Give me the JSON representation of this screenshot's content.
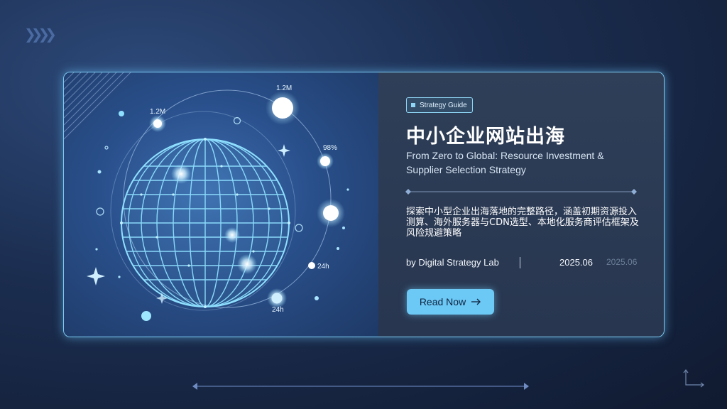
{
  "card": {
    "badge": {
      "icon": "square-icon",
      "label": "Strategy Guide"
    },
    "title": "中小企业网站出海",
    "subtitle": "From Zero to Global: Resource Investment & Supplier Selection Strategy",
    "description": "探索中小型企业出海落地的完整路径，涵盖初期资源投入测算、海外服务器与CDN选型、本地化服务商评估框架及风险规避策略",
    "author": "by Digital Strategy Lab",
    "date": "2025.06",
    "date_ghost": "2025.06",
    "cta": {
      "label": "Read Now",
      "icon": "arrow-right-icon"
    }
  },
  "illustration": {
    "labels": [
      "1.2M",
      "1.2M",
      "98%",
      "24h",
      "24h"
    ]
  },
  "colors": {
    "accent": "#6cc8f5",
    "border": "#7ecbf2",
    "background": "#1b2d4f"
  }
}
